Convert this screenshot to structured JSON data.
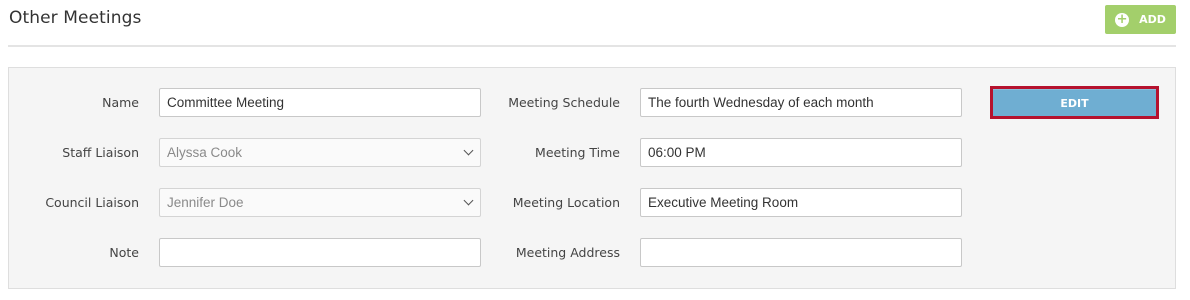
{
  "header": {
    "title": "Other Meetings",
    "add_label": "ADD",
    "add_color": "#a3cf6b"
  },
  "form": {
    "name": {
      "label": "Name",
      "value": "Committee Meeting"
    },
    "staff_liaison": {
      "label": "Staff Liaison",
      "value": "Alyssa Cook"
    },
    "council_liaison": {
      "label": "Council Liaison",
      "value": "Jennifer Doe"
    },
    "note": {
      "label": "Note",
      "value": ""
    },
    "meeting_schedule": {
      "label": "Meeting Schedule",
      "value": "The fourth Wednesday of each month"
    },
    "meeting_time": {
      "label": "Meeting Time",
      "value": "06:00 PM"
    },
    "meeting_location": {
      "label": "Meeting Location",
      "value": "Executive Meeting Room"
    },
    "meeting_address": {
      "label": "Meeting Address",
      "value": ""
    }
  },
  "actions": {
    "edit_label": "EDIT",
    "edit_color": "#6faed2",
    "highlight_color": "#b5122e"
  }
}
